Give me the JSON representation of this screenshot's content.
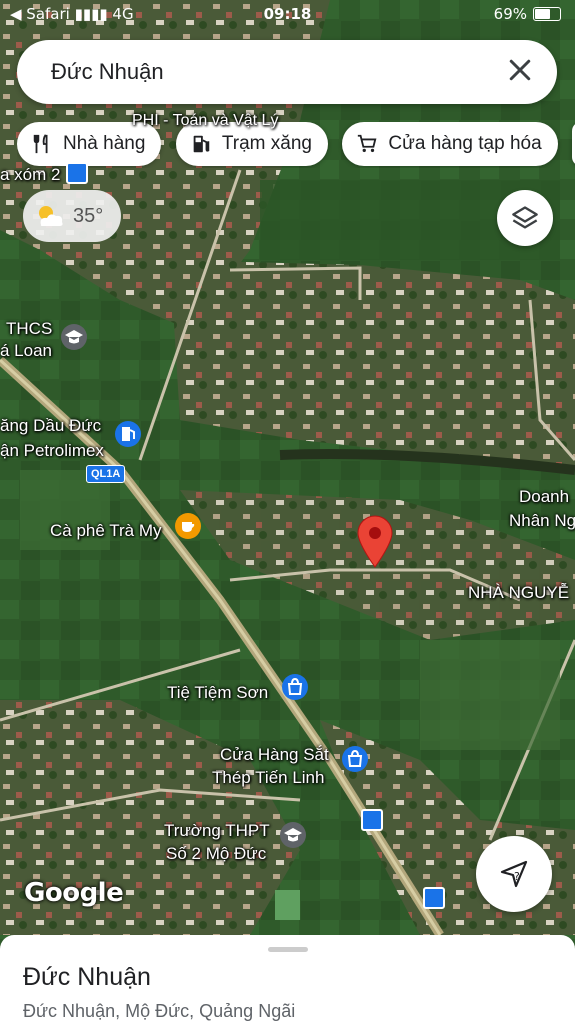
{
  "status_bar": {
    "carrier": "◀ Safari",
    "network": "4G",
    "time": "09:18",
    "battery": "69%",
    "battery_level": 0.69
  },
  "search": {
    "query": "Đức Nhuận"
  },
  "chips": [
    {
      "label": "Nhà hàng",
      "icon": "fork-knife-icon"
    },
    {
      "label": "Trạm xăng",
      "icon": "gas-station-icon"
    },
    {
      "label": "Cửa hàng tạp hóa",
      "icon": "cart-icon"
    }
  ],
  "weather": {
    "temp": "35°",
    "icon": "partly-cloudy-icon"
  },
  "map_labels": {
    "phi": "PHI - Toán và Vật Lý",
    "xom2": "a xóm 2",
    "thcs_1": "THCS",
    "thcs_2": "á Loan",
    "petrol_1": "ăng Dầu Đức",
    "petrol_2": "ận Petrolimex",
    "road": "QL1A",
    "cafe": "Cà phê Trà My",
    "doanh_1": "Doanh",
    "doanh_2": "Nhân Ng",
    "nha": "NHÀ NGUYỄ",
    "tiem": "Tiệ Tiệm Sơn",
    "steel_1": "Cửa Hàng Sắt",
    "steel_2": "Thép Tiến Linh",
    "school_1": "Trường THPT",
    "school_2": "Số 2 Mộ Đức"
  },
  "attribution": "Google",
  "place": {
    "name": "Đức Nhuận",
    "address": "Đức Nhuận, Mộ Đức, Quảng Ngãi"
  },
  "colors": {
    "pin": "#ea4335",
    "poi_blue": "#1a73e8",
    "poi_orange": "#f29900",
    "school_gray": "#5f6368"
  }
}
